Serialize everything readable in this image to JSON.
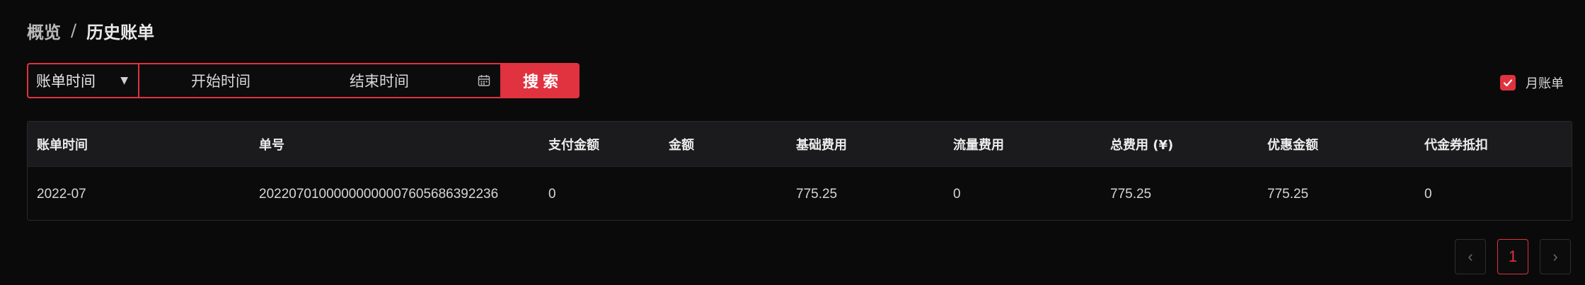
{
  "breadcrumb": {
    "root": "概览",
    "separator": "/",
    "current": "历史账单"
  },
  "filter": {
    "select_value": "账单时间",
    "start_placeholder": "开始时间",
    "end_placeholder": "结束时间",
    "search_label": "搜索"
  },
  "monthly": {
    "label": "月账单",
    "checked": true
  },
  "table": {
    "headers": {
      "bill_time": "账单时间",
      "bill_no": "单号",
      "paid_amount": "支付金额",
      "clipped_amount": "金额",
      "base_fee": "基础费用",
      "traffic_fee": "流量费用",
      "total_fee": "总费用 (¥)",
      "discount": "优惠金额",
      "voucher": "代金券抵扣"
    },
    "rows": [
      {
        "bill_time": "2022-07",
        "bill_no": "202207010000000000076056863922​36",
        "paid_amount": "0",
        "clipped_amount": "",
        "base_fee": "775.25",
        "traffic_fee": "0",
        "total_fee": "775.25",
        "discount": "775.25",
        "voucher": "0"
      }
    ]
  },
  "pagination": {
    "prev": "‹",
    "current": "1",
    "next": "›"
  },
  "colors": {
    "accent": "#e0323f",
    "background": "#0a0a0b",
    "header_bg": "#1b1b1d"
  }
}
